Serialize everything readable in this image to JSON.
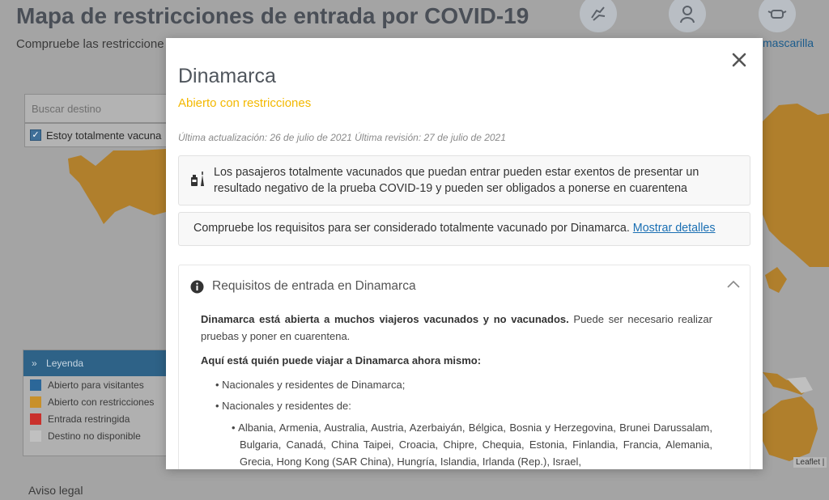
{
  "page": {
    "title": "Mapa de restricciones de entrada por COVID-19",
    "subtitle": "Compruebe las restriccione",
    "mask_label": "mascarilla",
    "search_placeholder": "Buscar destino",
    "vaccinated_checkbox": "Estoy totalmente vacuna",
    "aviso_legal": "Aviso legal",
    "leaflet": "Leaflet |"
  },
  "legend": {
    "title": "Leyenda",
    "items": [
      {
        "label": "Abierto para visitantes",
        "color": "#2b6799"
      },
      {
        "label": "Abierto con restricciones",
        "color": "#c8902a"
      },
      {
        "label": "Entrada restringida",
        "color": "#c9302c"
      },
      {
        "label": "Destino no disponible",
        "color": "#c0c0c0"
      }
    ]
  },
  "modal": {
    "country": "Dinamarca",
    "status": "Abierto con restricciones",
    "status_color": "#f3b800",
    "updated": "Última actualización: 26 de julio de 2021 Última revisión: 27 de julio de 2021",
    "vaccinated_note": "Los pasajeros totalmente vacunados que puedan entrar pueden estar exentos de presentar un resultado negativo de la prueba COVID-19 y pueden ser obligados a ponerse en cuarentena",
    "requirements_text": "Compruebe los requisitos para ser considerado totalmente vacunado por Dinamarca.",
    "requirements_link": "Mostrar detalles",
    "accordion_title": "Requisitos de entrada en Dinamarca",
    "lead_bold": "Dinamarca está abierta a muchos viajeros vacunados y no vacunados.",
    "lead_rest": " Puede ser necesario realizar pruebas y poner en cuarentena.",
    "who_title": "Aquí está quién puede viajar a Dinamarca ahora mismo:",
    "item1": "• Nacionales y residentes de Dinamarca;",
    "item2": "• Nacionales y residentes de:",
    "countries": "• Albania, Armenia, Australia, Austria, Azerbaiyán, Bélgica, Bosnia y Herzegovina, Brunei Darussalam, Bulgaria, Canadá, China Taipei, Croacia, Chipre, Chequia, Estonia, Finlandia, Francia, Alemania, Grecia, Hong Kong (SAR China), Hungría, Islandia, Irlanda (Rep.), Israel,"
  }
}
